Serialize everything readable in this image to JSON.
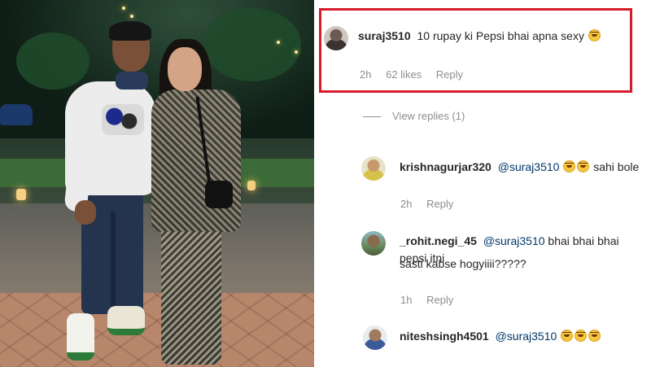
{
  "comments": [
    {
      "username": "suraj3510",
      "mention": "",
      "text": "10 rupay ki Pepsi bhai apna sexy",
      "emojis": [
        "grinning-sweat-emoji"
      ],
      "time": "2h",
      "likes": "62 likes",
      "reply_label": "Reply"
    },
    {
      "username": "krishnagurjar320",
      "mention": "@suraj3510",
      "text": "sahi bole",
      "emojis": [
        "grinning-sweat-emoji",
        "grinning-sweat-emoji"
      ],
      "time": "2h",
      "likes": "",
      "reply_label": "Reply"
    },
    {
      "username": "_rohit.negi_45",
      "mention": "@suraj3510",
      "text": "bhai bhai bhai pepsi itni",
      "text_line2": "sasti kabse hogyiiii?????",
      "time": "1h",
      "likes": "",
      "reply_label": "Reply"
    },
    {
      "username": "niteshsingh4501",
      "mention": "@suraj3510",
      "text": "",
      "emojis": [
        "grinning-sweat-emoji",
        "grinning-sweat-emoji",
        "grinning-sweat-emoji"
      ]
    }
  ],
  "view_replies": "View replies (1)",
  "colors": {
    "highlight_border": "#d81b2c",
    "mention": "#00376b",
    "meta_gray": "#8e8e8e"
  }
}
